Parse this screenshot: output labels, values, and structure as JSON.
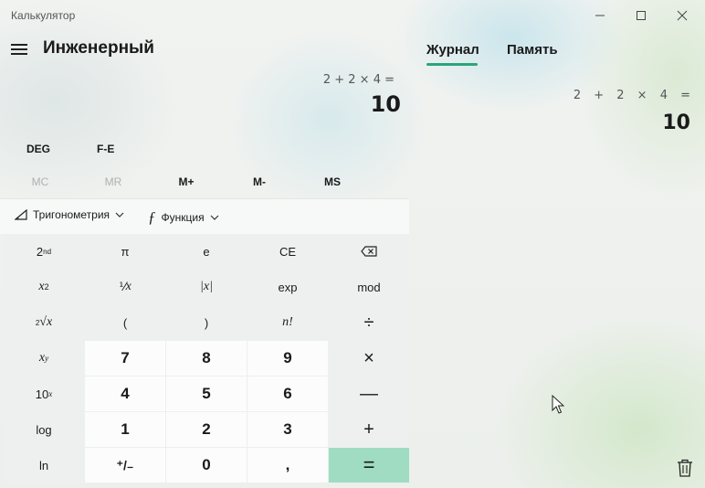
{
  "window": {
    "title": "Калькулятор"
  },
  "header": {
    "mode_title": "Инженерный"
  },
  "display": {
    "expression": "2 + 2 × 4 =",
    "result": "10"
  },
  "modes": {
    "angle": "DEG",
    "fe": "F-E"
  },
  "memory": {
    "mc": "MC",
    "mr": "MR",
    "mplus": "M+",
    "mminus": "M-",
    "ms": "MS"
  },
  "functions": {
    "trig": "Тригонометрия",
    "func": "Функция"
  },
  "keys": {
    "second": "2",
    "second_sup": "nd",
    "pi": "π",
    "e": "e",
    "ce": "CE",
    "x": "x",
    "sq_sup": "2",
    "recip": "⅟",
    "recip_x": "x",
    "abs": "|x|",
    "exp": "exp",
    "mod": "mod",
    "root_idx": "2",
    "root_x": "√x",
    "lparen": "(",
    "rparen": ")",
    "fact": "n!",
    "divide": "÷",
    "xy_sup": "y",
    "seven": "7",
    "eight": "8",
    "nine": "9",
    "multiply": "×",
    "ten": "10",
    "ten_sup": "x",
    "four": "4",
    "five": "5",
    "six": "6",
    "minus": "—",
    "log": "log",
    "one": "1",
    "two": "2",
    "three": "3",
    "plus": "+",
    "ln": "ln",
    "negate": "⁺/₋",
    "zero": "0",
    "comma": ",",
    "equals": "="
  },
  "tabs": {
    "history": "Журнал",
    "memory": "Память"
  },
  "history": {
    "expression": "2 + 2 × 4 =",
    "result": "10"
  },
  "colors": {
    "accent": "#2aa57a",
    "equals_bg": "#9fdcc2"
  }
}
